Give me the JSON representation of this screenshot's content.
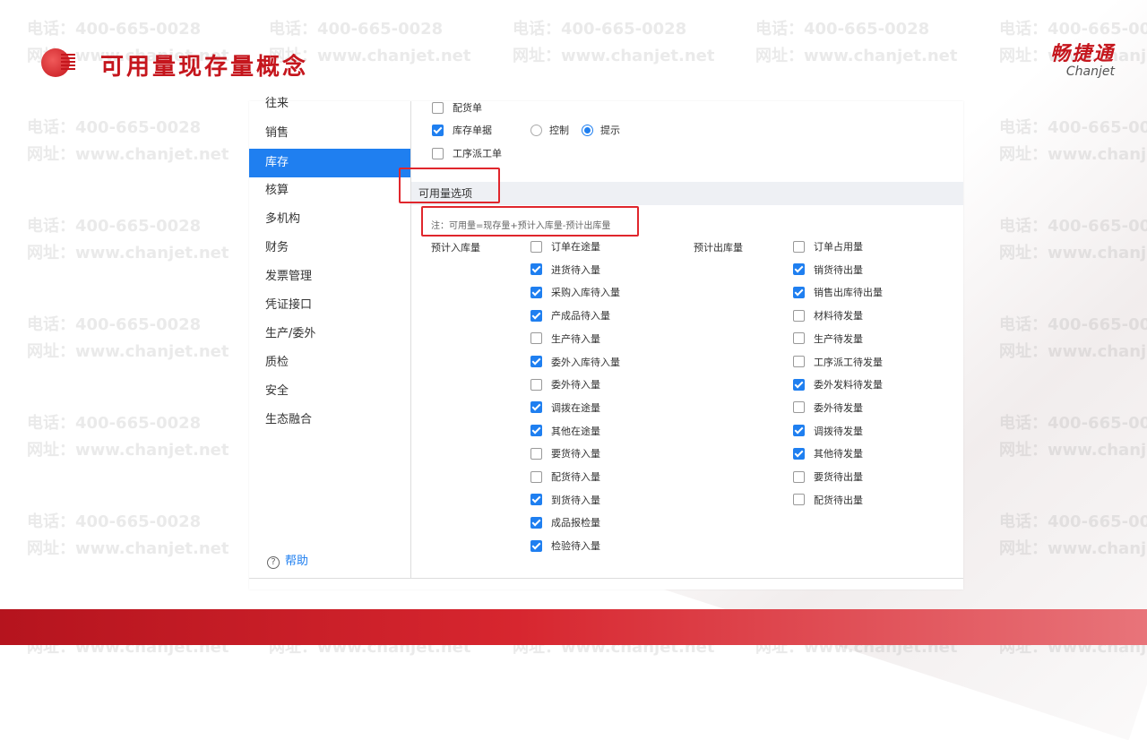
{
  "header": {
    "title": "可用量现存量概念",
    "brand_cn": "畅捷通",
    "brand_en": "Chanjet"
  },
  "watermark": {
    "phone": "电话：400-665-0028",
    "site": "网址：www.chanjet.net"
  },
  "sidebar": {
    "items": [
      "往来",
      "销售",
      "库存",
      "核算",
      "多机构",
      "财务",
      "发票管理",
      "凭证接口",
      "生产/委外",
      "质检",
      "安全",
      "生态融合"
    ],
    "active": "库存",
    "help": "帮助"
  },
  "top_options": {
    "peihuo": "配货单",
    "kucun_danju": "库存单据",
    "kongzhi": "控制",
    "tishi": "提示",
    "gongxu": "工序派工单"
  },
  "section": {
    "title": "可用量选项",
    "note": "注：可用量=现存量+预计入库量-预计出库量"
  },
  "inbound": {
    "label": "预计入库量",
    "items": [
      {
        "label": "订单在途量",
        "checked": false
      },
      {
        "label": "进货待入量",
        "checked": true
      },
      {
        "label": "采购入库待入量",
        "checked": true
      },
      {
        "label": "产成品待入量",
        "checked": true
      },
      {
        "label": "生产待入量",
        "checked": false
      },
      {
        "label": "委外入库待入量",
        "checked": true
      },
      {
        "label": "委外待入量",
        "checked": false
      },
      {
        "label": "调拨在途量",
        "checked": true
      },
      {
        "label": "其他在途量",
        "checked": true
      },
      {
        "label": "要货待入量",
        "checked": false
      },
      {
        "label": "配货待入量",
        "checked": false
      },
      {
        "label": "到货待入量",
        "checked": true
      },
      {
        "label": "成品报检量",
        "checked": true
      },
      {
        "label": "检验待入量",
        "checked": true
      }
    ]
  },
  "outbound": {
    "label": "预计出库量",
    "items": [
      {
        "label": "订单占用量",
        "checked": false
      },
      {
        "label": "销货待出量",
        "checked": true
      },
      {
        "label": "销售出库待出量",
        "checked": true
      },
      {
        "label": "材料待发量",
        "checked": false
      },
      {
        "label": "生产待发量",
        "checked": false
      },
      {
        "label": "工序派工待发量",
        "checked": false
      },
      {
        "label": "委外发料待发量",
        "checked": true
      },
      {
        "label": "委外待发量",
        "checked": false
      },
      {
        "label": "调拨待发量",
        "checked": true
      },
      {
        "label": "其他待发量",
        "checked": true
      },
      {
        "label": "要货待出量",
        "checked": false
      },
      {
        "label": "配货待出量",
        "checked": false
      }
    ]
  }
}
